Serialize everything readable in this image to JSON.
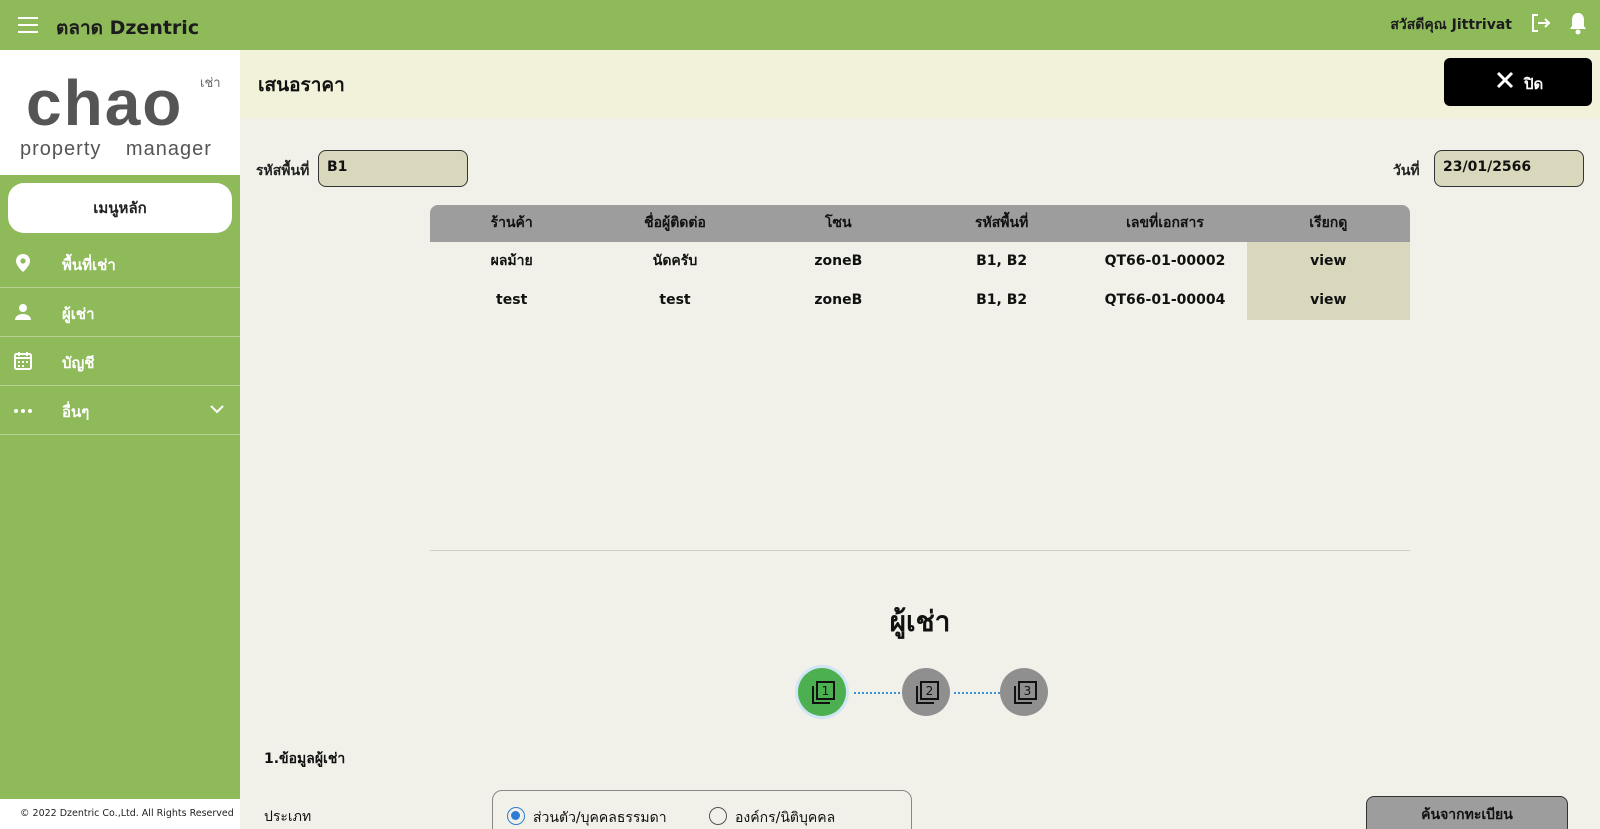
{
  "header": {
    "app_title": "ตลาด Dzentric",
    "greeting": "สวัสดีคุณ Jittrivat",
    "icons": [
      "menu-icon",
      "logout-icon",
      "bell-icon"
    ]
  },
  "sidebar": {
    "logo": {
      "main": "chao",
      "sub": "เช่า",
      "tagline": "property manager"
    },
    "main_menu_label": "เมนูหลัก",
    "items": [
      {
        "label": "พื้นที่เช่า",
        "icon": "location-pin-icon"
      },
      {
        "label": "ผู้เช่า",
        "icon": "person-icon"
      },
      {
        "label": "บัญชี",
        "icon": "calendar-icon"
      },
      {
        "label": "อื่นๆ",
        "icon": "more-dots-icon"
      }
    ],
    "copyright": "© 2022  Dzentric Co.,Ltd. All Rights Reserved"
  },
  "page": {
    "title": "เสนอราคา",
    "close_label": "ปิด"
  },
  "form": {
    "area_code_label": "รหัสพื้นที่",
    "area_code_value": "B1",
    "date_label": "วันที่",
    "date_value": "23/01/2566"
  },
  "table": {
    "columns": [
      "ร้านค้า",
      "ชื่อผู้ติดต่อ",
      "โซน",
      "รหัสพื้นที่",
      "เลขที่เอกสาร",
      "เรียกดู"
    ],
    "rows": [
      {
        "shop": "ผลม้าย",
        "contact": "นัดครับ",
        "zone": "zoneB",
        "area": "B1, B2",
        "doc_no": "QT66-01-00002",
        "action": "view"
      },
      {
        "shop": "test",
        "contact": "test",
        "zone": "zoneB",
        "area": "B1, B2",
        "doc_no": "QT66-01-00004",
        "action": "view"
      }
    ]
  },
  "tenant": {
    "section_title": "ผู้เช่า",
    "steps": [
      {
        "number": "1",
        "active": true
      },
      {
        "number": "2",
        "active": false
      },
      {
        "number": "3",
        "active": false
      }
    ],
    "subsection_title": "1.ข้อมูลผู้เช่า",
    "type_label": "ประเภท",
    "type_options": [
      {
        "label": "ส่วนตัว/บุคคลธรรมดา",
        "checked": true
      },
      {
        "label": "องค์กร/นิติบุคคล",
        "checked": false
      }
    ],
    "search_registry_label": "ค้นจากทะเบียน"
  },
  "colors": {
    "brand_green": "#8fba5a",
    "header_bg": "#f2f1da",
    "input_bg": "#d9d8bc",
    "table_header": "#9d9d9d",
    "step_active": "#4caf50",
    "radio_accent": "#2d7dd2"
  }
}
